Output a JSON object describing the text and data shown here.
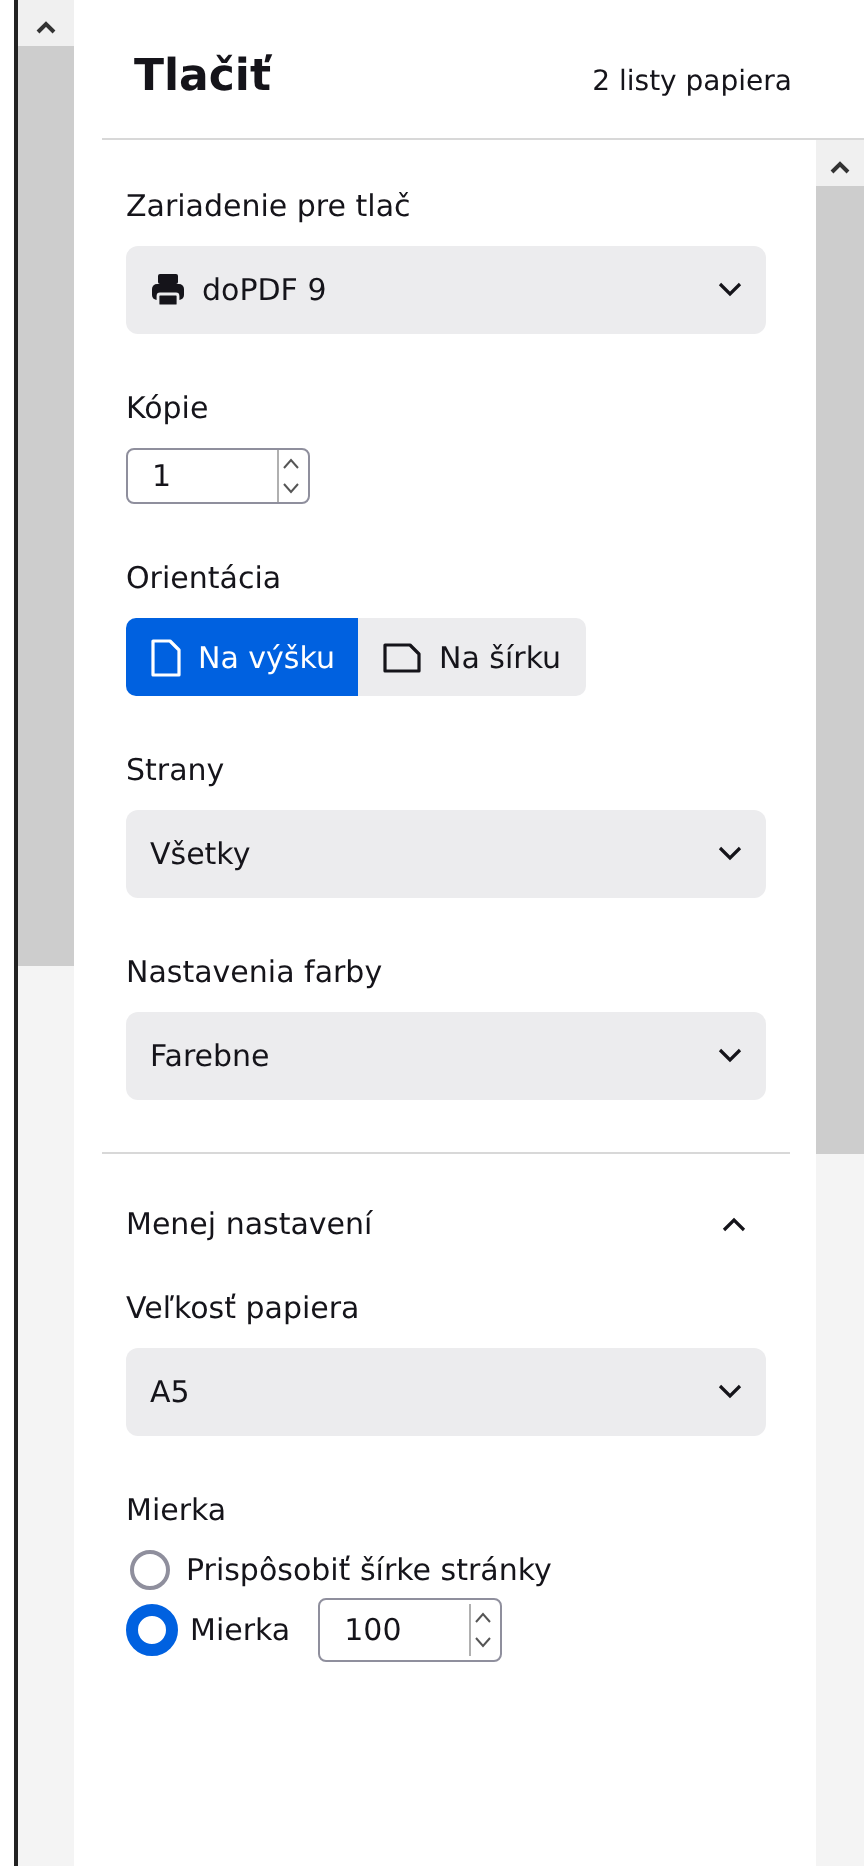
{
  "header": {
    "title": "Tlačiť",
    "sheets": "2 listy papiera"
  },
  "destination": {
    "label": "Zariadenie pre tlač",
    "value": "doPDF 9"
  },
  "copies": {
    "label": "Kópie",
    "value": "1"
  },
  "orientation": {
    "label": "Orientácia",
    "options": [
      {
        "label": "Na výšku",
        "kind": "portrait",
        "selected": true
      },
      {
        "label": "Na šírku",
        "kind": "landscape",
        "selected": false
      }
    ]
  },
  "pages": {
    "label": "Strany",
    "value": "Všetky"
  },
  "color": {
    "label": "Nastavenia farby",
    "value": "Farebne"
  },
  "more_settings": {
    "label": "Menej nastavení",
    "expanded": true
  },
  "paper_size": {
    "label": "Veľkosť papiera",
    "value": "A5"
  },
  "scale": {
    "label": "Mierka",
    "options": [
      {
        "label": "Prispôsobiť šírke stránky",
        "selected": false
      },
      {
        "label": "Mierka",
        "selected": true,
        "value": "100"
      }
    ]
  }
}
